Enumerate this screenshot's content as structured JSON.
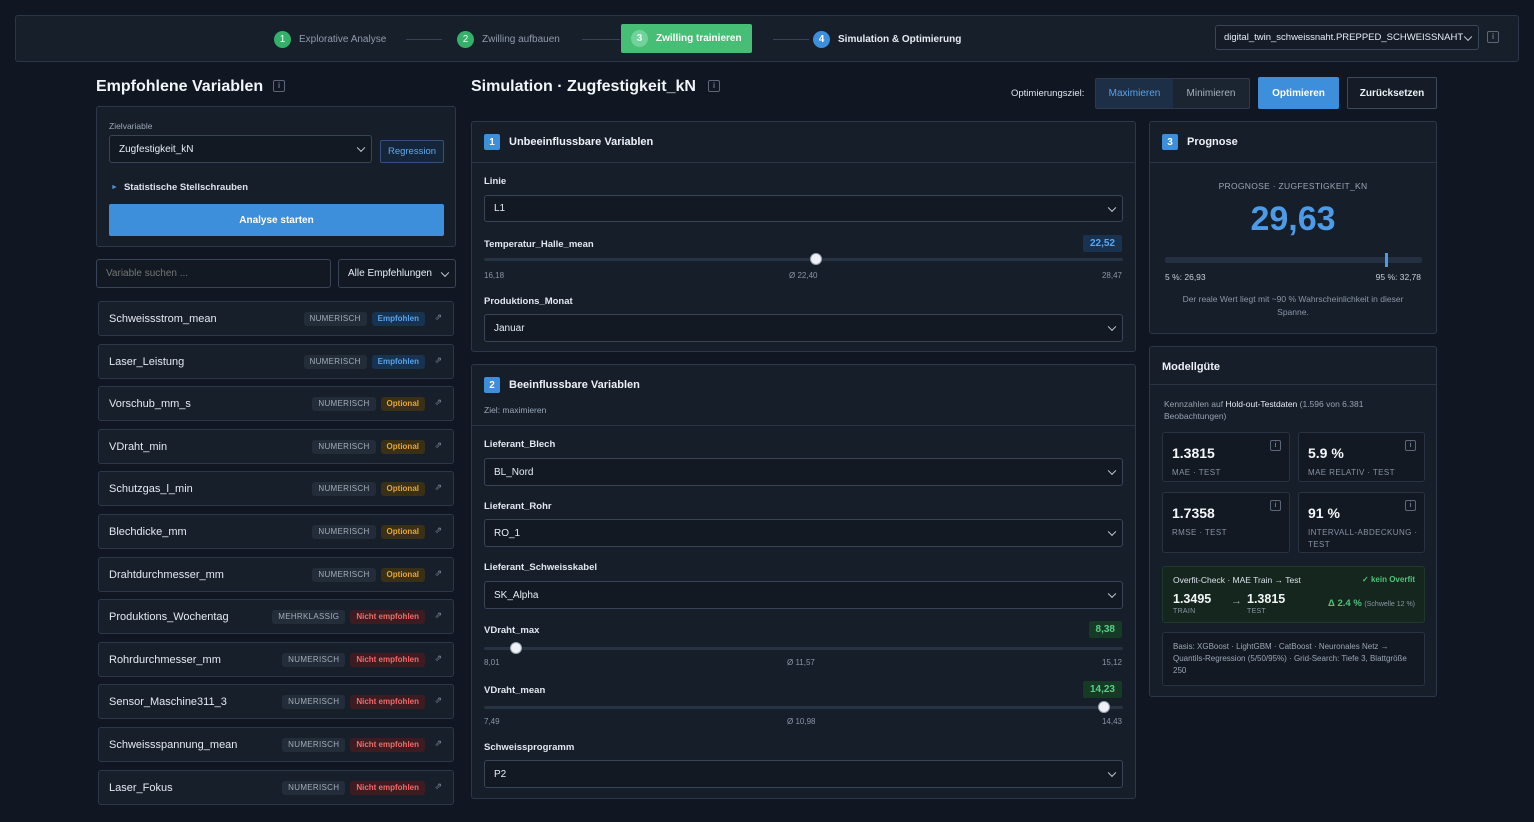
{
  "steps": [
    {
      "num": "1",
      "label": "Explorative Analyse"
    },
    {
      "num": "2",
      "label": "Zwilling aufbauen"
    },
    {
      "num": "3",
      "label": "Zwilling trainieren"
    },
    {
      "num": "4",
      "label": "Simulation & Optimierung"
    }
  ],
  "dataset": {
    "value": "digital_twin_schweissnaht.PREPPED_SCHWEISSNAHT",
    "info": "i"
  },
  "left": {
    "title": "Empfohlene Variablen",
    "info": "i",
    "target_label": "Zielvariable",
    "target_value": "Zugfestigkeit_kN",
    "mode_button": "Regression",
    "stell_label": "Statistische Stellschrauben",
    "start_button": "Analyse starten",
    "search_placeholder": "Variable suchen ...",
    "filter_value": "Alle Empfehlungen",
    "variables": [
      {
        "name": "Schweissstrom_mean",
        "type": "NUMERISCH",
        "rec": "Empfohlen"
      },
      {
        "name": "Laser_Leistung",
        "type": "NUMERISCH",
        "rec": "Empfohlen"
      },
      {
        "name": "Vorschub_mm_s",
        "type": "NUMERISCH",
        "rec": "Optional"
      },
      {
        "name": "VDraht_min",
        "type": "NUMERISCH",
        "rec": "Optional"
      },
      {
        "name": "Schutzgas_l_min",
        "type": "NUMERISCH",
        "rec": "Optional"
      },
      {
        "name": "Blechdicke_mm",
        "type": "NUMERISCH",
        "rec": "Optional"
      },
      {
        "name": "Drahtdurchmesser_mm",
        "type": "NUMERISCH",
        "rec": "Optional"
      },
      {
        "name": "Produktions_Wochentag",
        "type": "MEHRKLASSIG",
        "rec": "Nicht empfohlen"
      },
      {
        "name": "Rohrdurchmesser_mm",
        "type": "NUMERISCH",
        "rec": "Nicht empfohlen"
      },
      {
        "name": "Sensor_Maschine311_3",
        "type": "NUMERISCH",
        "rec": "Nicht empfohlen"
      },
      {
        "name": "Schweissspannung_mean",
        "type": "NUMERISCH",
        "rec": "Nicht empfohlen"
      },
      {
        "name": "Laser_Fokus",
        "type": "NUMERISCH",
        "rec": "Nicht empfohlen"
      }
    ]
  },
  "sim": {
    "title": "Simulation · Zugfestigkeit_kN",
    "info": "i",
    "opt_label": "Optimierungsziel:",
    "max_label": "Maximieren",
    "min_label": "Minimieren",
    "optimize_button": "Optimieren",
    "reset_button": "Zurücksetzen"
  },
  "section1": {
    "num": "1",
    "title": "Unbeeinflussbare Variablen",
    "linie_label": "Linie",
    "linie_value": "L1",
    "temp_label": "Temperatur_Halle_mean",
    "temp_value": "22,52",
    "temp_min": "16,18",
    "temp_avg": "Ø 22,40",
    "temp_max": "28,47",
    "temp_fraction": 0.52,
    "monat_label": "Produktions_Monat",
    "monat_value": "Januar"
  },
  "section2": {
    "num": "2",
    "title": "Beeinflussbare Variablen",
    "subtitle": "Ziel: maximieren",
    "blech_label": "Lieferant_Blech",
    "blech_value": "BL_Nord",
    "rohr_label": "Lieferant_Rohr",
    "rohr_value": "RO_1",
    "kabel_label": "Lieferant_Schweisskabel",
    "kabel_value": "SK_Alpha",
    "vmax_label": "VDraht_max",
    "vmax_value": "8,38",
    "vmax_min": "8,01",
    "vmax_avg": "Ø 11,57",
    "vmax_max": "15,12",
    "vmax_fraction": 0.05,
    "vmean_label": "VDraht_mean",
    "vmean_value": "14,23",
    "vmean_min": "7,49",
    "vmean_avg": "Ø 10,98",
    "vmean_max": "14,43",
    "vmean_fraction": 0.97,
    "prog_label": "Schweissprogramm",
    "prog_value": "P2"
  },
  "prognose": {
    "num": "3",
    "title": "Prognose",
    "caption": "PROGNOSE · ZUGFESTIGKEIT_KN",
    "value": "29,63",
    "low": "5 %: 26,93",
    "high": "95 %: 32,78",
    "marker_fraction": 0.86,
    "note": "Der reale Wert liegt mit ~90 % Wahrscheinlichkeit in dieser Spanne."
  },
  "model": {
    "title": "Modellgüte",
    "desc_pre": "Kennzahlen auf ",
    "desc_bold": "Hold-out-Testdaten",
    "desc_post": " (1.596 von 6.381 Beobachtungen)",
    "kpis": [
      {
        "value": "1.3815",
        "label": "MAE · TEST"
      },
      {
        "value": "5.9 %",
        "label": "MAE RELATIV · TEST"
      },
      {
        "value": "1.7358",
        "label": "RMSE · TEST"
      },
      {
        "value": "91 %",
        "label": "INTERVALL-ABDECKUNG · TEST"
      }
    ],
    "overfit_title": "Overfit-Check · MAE Train → Test",
    "overfit_status": "✓ kein Overfit",
    "train_value": "1.3495",
    "train_label": "TRAIN",
    "arrow": "→",
    "test_value": "1.3815",
    "test_label": "TEST",
    "delta": "Δ 2.4 %",
    "threshold": "(Schwelle 12 %)",
    "basis": "Basis: XGBoost · LightGBM · CatBoost · Neuronales Netz → Quantils-Regression (5/50/95%) · Grid-Search: Tiefe 3, Blattgröße 250"
  }
}
